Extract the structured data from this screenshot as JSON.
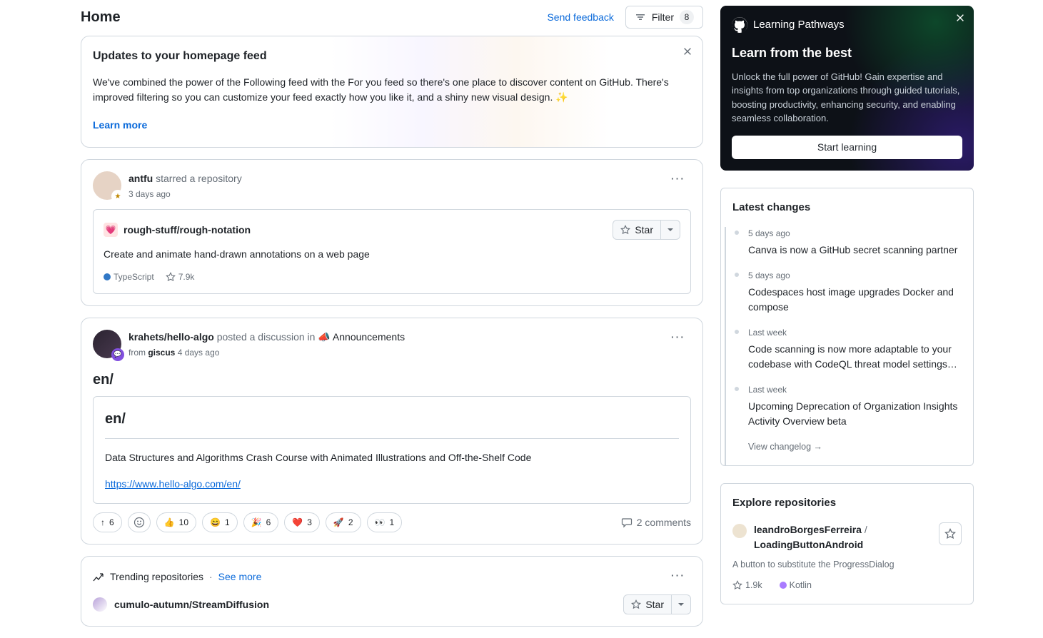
{
  "header": {
    "title": "Home",
    "send_feedback": "Send feedback",
    "filter_label": "Filter",
    "filter_count": "8"
  },
  "notice": {
    "title": "Updates to your homepage feed",
    "body": "We've combined the power of the Following feed with the For you feed so there's one place to discover content on GitHub. There's improved filtering so you can customize your feed exactly how you like it, and a shiny new visual design. ✨",
    "link": "Learn more"
  },
  "feed": {
    "item1": {
      "actor": "antfu",
      "action": " starred a repository",
      "time": "3 days ago",
      "repo": {
        "icon": "💗",
        "name": "rough-stuff/rough-notation",
        "desc": "Create and animate hand-drawn annotations on a web page",
        "lang": "TypeScript",
        "lang_color": "#3178c6",
        "stars": "7.9k"
      },
      "star_label": "Star"
    },
    "item2": {
      "actor": "krahets/hello-algo",
      "action": " posted a discussion in ",
      "category_icon": "📣",
      "category": "Announcements",
      "from_label": "from ",
      "from_repo": "giscus",
      "time": "4 days ago",
      "title": "en/",
      "box_title": "en/",
      "box_body": "Data Structures and Algorithms Crash Course with Animated Illustrations and Off-the-Shelf Code",
      "box_link": "https://www.hello-algo.com/en/",
      "reactions": [
        {
          "icon": "↑",
          "count": "6"
        },
        {
          "icon": "👍",
          "count": "10"
        },
        {
          "icon": "😄",
          "count": "1"
        },
        {
          "icon": "🎉",
          "count": "6"
        },
        {
          "icon": "❤️",
          "count": "3"
        },
        {
          "icon": "🚀",
          "count": "2"
        },
        {
          "icon": "👀",
          "count": "1"
        }
      ],
      "comments": "2 comments"
    },
    "trending": {
      "label": "Trending repositories",
      "see_more": "See more",
      "repo": "cumulo-autumn/StreamDiffusion",
      "star_label": "Star"
    }
  },
  "promo": {
    "logo_text": "Learning Pathways",
    "title": "Learn from the best",
    "body": "Unlock the full power of GitHub! Gain expertise and insights from top organizations through guided tutorials, boosting productivity, enhancing security, and enabling seamless collaboration.",
    "button": "Start learning"
  },
  "changes": {
    "heading": "Latest changes",
    "items": [
      {
        "time": "5 days ago",
        "title": "Canva is now a GitHub secret scanning partner"
      },
      {
        "time": "5 days ago",
        "title": "Codespaces host image upgrades Docker and compose"
      },
      {
        "time": "Last week",
        "title": "Code scanning is now more adaptable to your codebase with CodeQL threat model settings…"
      },
      {
        "time": "Last week",
        "title": "Upcoming Deprecation of Organization Insights Activity Overview beta"
      }
    ],
    "view": "View changelog →"
  },
  "explore": {
    "heading": "Explore repositories",
    "repo": {
      "owner": "leandroBorgesFerreira",
      "name": "LoadingButtonAndroid",
      "desc": "A button to substitute the ProgressDialog",
      "stars": "1.9k",
      "lang": "Kotlin",
      "lang_color": "#a97bff"
    }
  }
}
